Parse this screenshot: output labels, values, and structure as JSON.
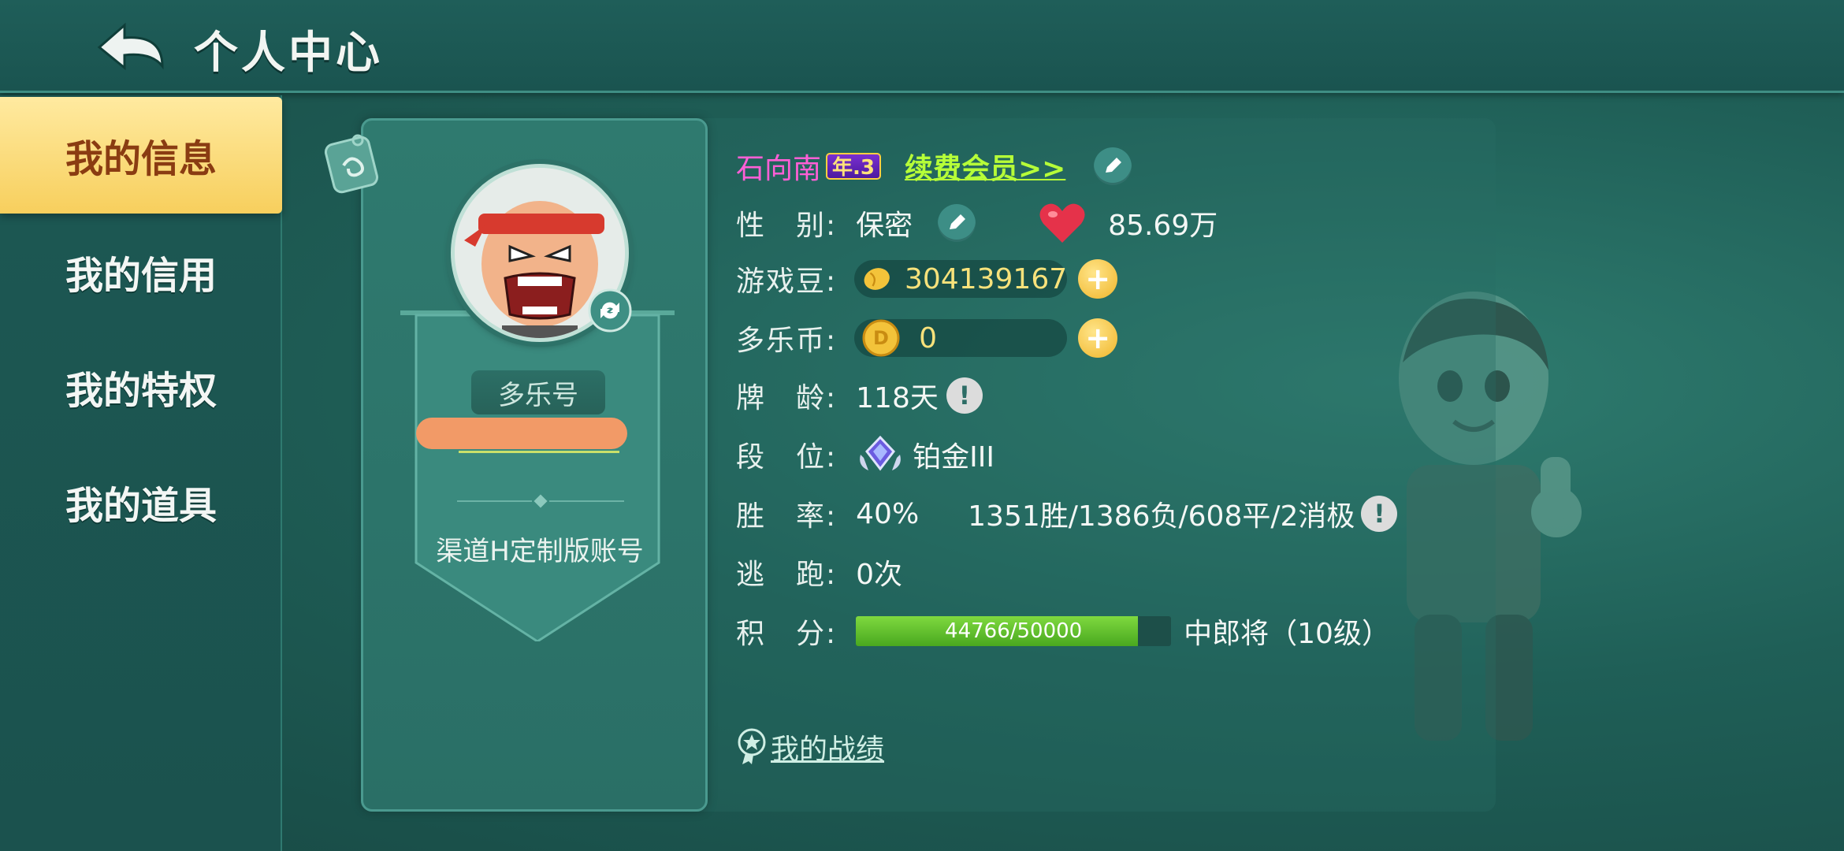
{
  "header": {
    "title": "个人中心"
  },
  "nav": [
    {
      "label": "我的信息",
      "active": true
    },
    {
      "label": "我的信用",
      "active": false
    },
    {
      "label": "我的特权",
      "active": false
    },
    {
      "label": "我的道具",
      "active": false
    }
  ],
  "card": {
    "id_label": "多乐号",
    "account_type": "渠道H定制版账号"
  },
  "profile": {
    "nickname": "石向南",
    "year_badge": "年.3",
    "renew_link": "续费会员>>",
    "gender_label": "性　别:",
    "gender_value": "保密",
    "likes_value": "85.69万",
    "beans_label": "游戏豆:",
    "beans_value": "304139167",
    "coins_label": "多乐币:",
    "coins_value": "0",
    "age_label": "牌　龄:",
    "age_value": "118天",
    "rank_label": "段　位:",
    "rank_value": "铂金III",
    "winrate_label": "胜　率:",
    "winrate_value": "40%",
    "record_value": "1351胜/1386负/608平/2消极",
    "escape_label": "逃　跑:",
    "escape_value": "0次",
    "score_label": "积　分:",
    "score_text": "44766/50000",
    "score_progress": 0.8953,
    "score_title": "中郎将（10级）",
    "record_link": "我的战绩"
  },
  "colors": {
    "accent_yellow": "#f7cf5d",
    "nickname_pink": "#ff5fd6",
    "renew_green": "#b6ff38",
    "progress_green": "#6cc832"
  },
  "icons": [
    "back-arrow-icon",
    "tag-icon",
    "refresh-icon",
    "pencil-icon",
    "heart-icon",
    "bean-icon",
    "coin-icon",
    "plus-icon",
    "info-icon",
    "diamond-rank-icon",
    "star-badge-icon"
  ]
}
